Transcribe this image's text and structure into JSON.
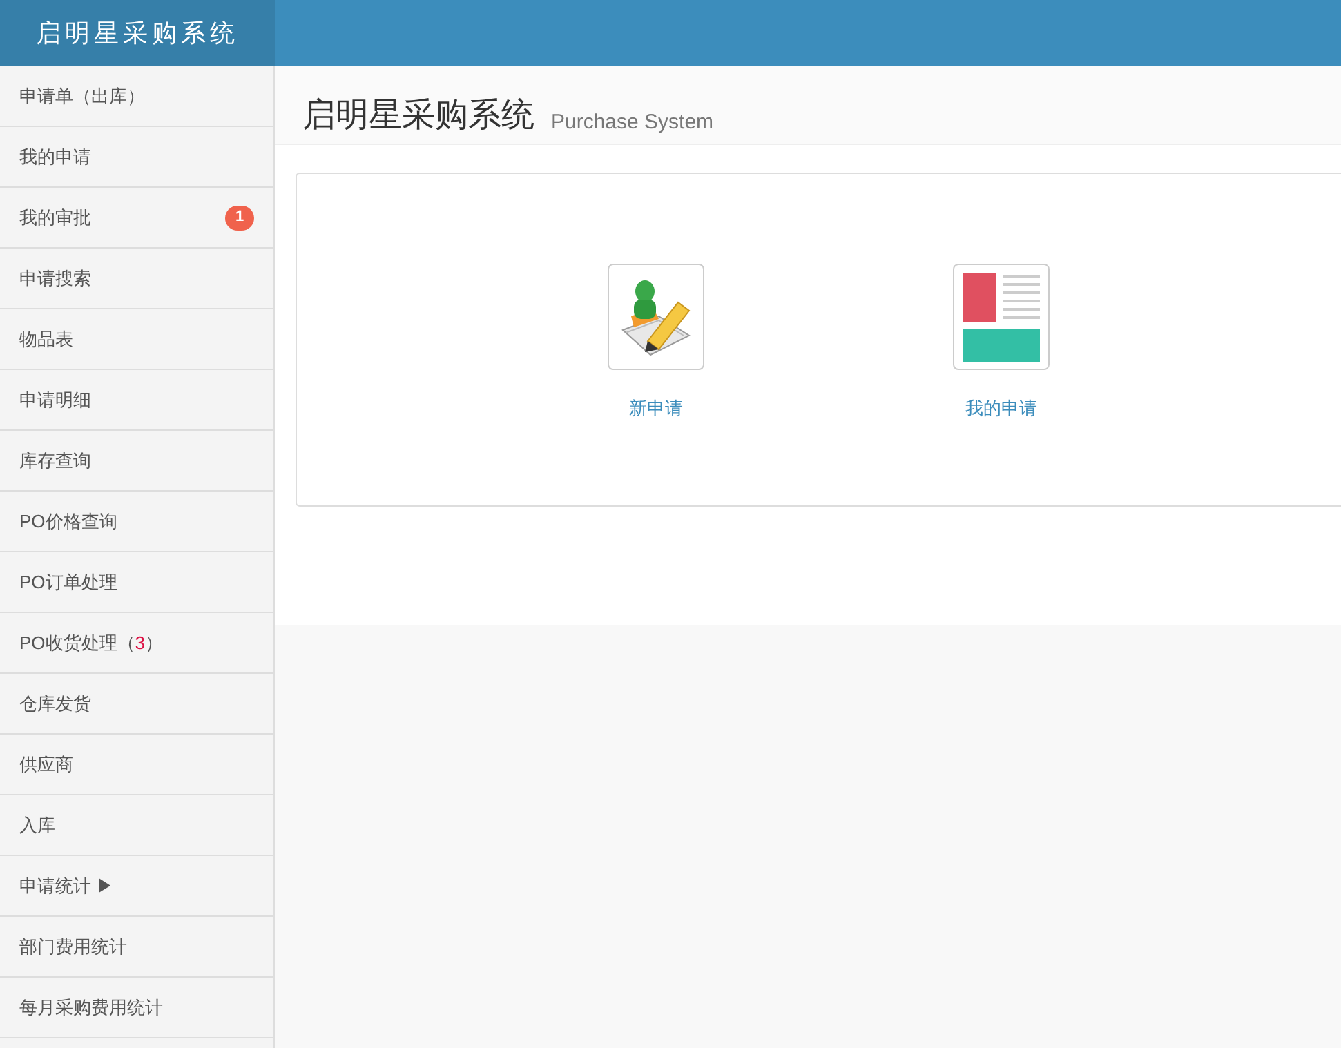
{
  "brand": "启明星采购系统",
  "sidebar": {
    "items": [
      {
        "label": "申请单（出库）"
      },
      {
        "label": "我的申请"
      },
      {
        "label": "我的审批",
        "badge": "1"
      },
      {
        "label": "申请搜索"
      },
      {
        "label": "物品表"
      },
      {
        "label": "申请明细"
      },
      {
        "label": "库存查询"
      },
      {
        "label": "PO价格查询"
      },
      {
        "label": "PO订单处理"
      },
      {
        "label": "PO收货处理（",
        "count": "3",
        "label_end": "）"
      },
      {
        "label": "仓库发货"
      },
      {
        "label": "供应商"
      },
      {
        "label": "入库"
      },
      {
        "label": "申请统计 ▶"
      },
      {
        "label": "部门费用统计"
      },
      {
        "label": "每月采购费用统计"
      }
    ]
  },
  "page_header": {
    "title": "启明星采购系统",
    "subtitle": "Purchase System"
  },
  "shortcuts": [
    {
      "kind": "new",
      "label": "新申请"
    },
    {
      "kind": "list",
      "label": "我的申请"
    }
  ]
}
